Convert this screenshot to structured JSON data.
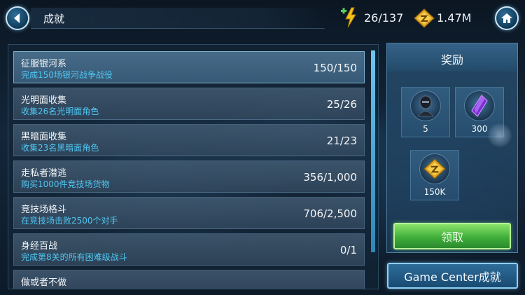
{
  "header": {
    "title": "成就",
    "energy": "26/137",
    "credits": "1.47M"
  },
  "achievements": [
    {
      "name": "征服银河系",
      "description": "完成150场银河战争战役",
      "progress": "150/150",
      "selected": true
    },
    {
      "name": "光明面收集",
      "description": "收集26名光明面角色",
      "progress": "25/26"
    },
    {
      "name": "黑暗面收集",
      "description": "收集23名黑暗面角色",
      "progress": "21/23"
    },
    {
      "name": "走私者潜逃",
      "description": "购买1000件竞技场货物",
      "progress": "356/1,000"
    },
    {
      "name": "竞技场格斗",
      "description": "在竞技场击败2500个对手",
      "progress": "706/2,500"
    },
    {
      "name": "身经百战",
      "description": "完成第8关的所有困难级战斗",
      "progress": "0/1"
    },
    {
      "name": "做或者不做",
      "description": "",
      "progress": ""
    }
  ],
  "reward": {
    "title": "奖励",
    "items": [
      {
        "icon": "character-shard-icon",
        "amount": "5"
      },
      {
        "icon": "purple-crystal-icon",
        "amount": "300"
      },
      {
        "icon": "credits-icon",
        "amount": "150K"
      }
    ],
    "claim_label": "领取"
  },
  "game_center_label": "Game Center成就",
  "colors": {
    "accent": "#4fc6f2",
    "claim_green": "#3fae3a",
    "panel_blue": "#1e3c5a"
  }
}
